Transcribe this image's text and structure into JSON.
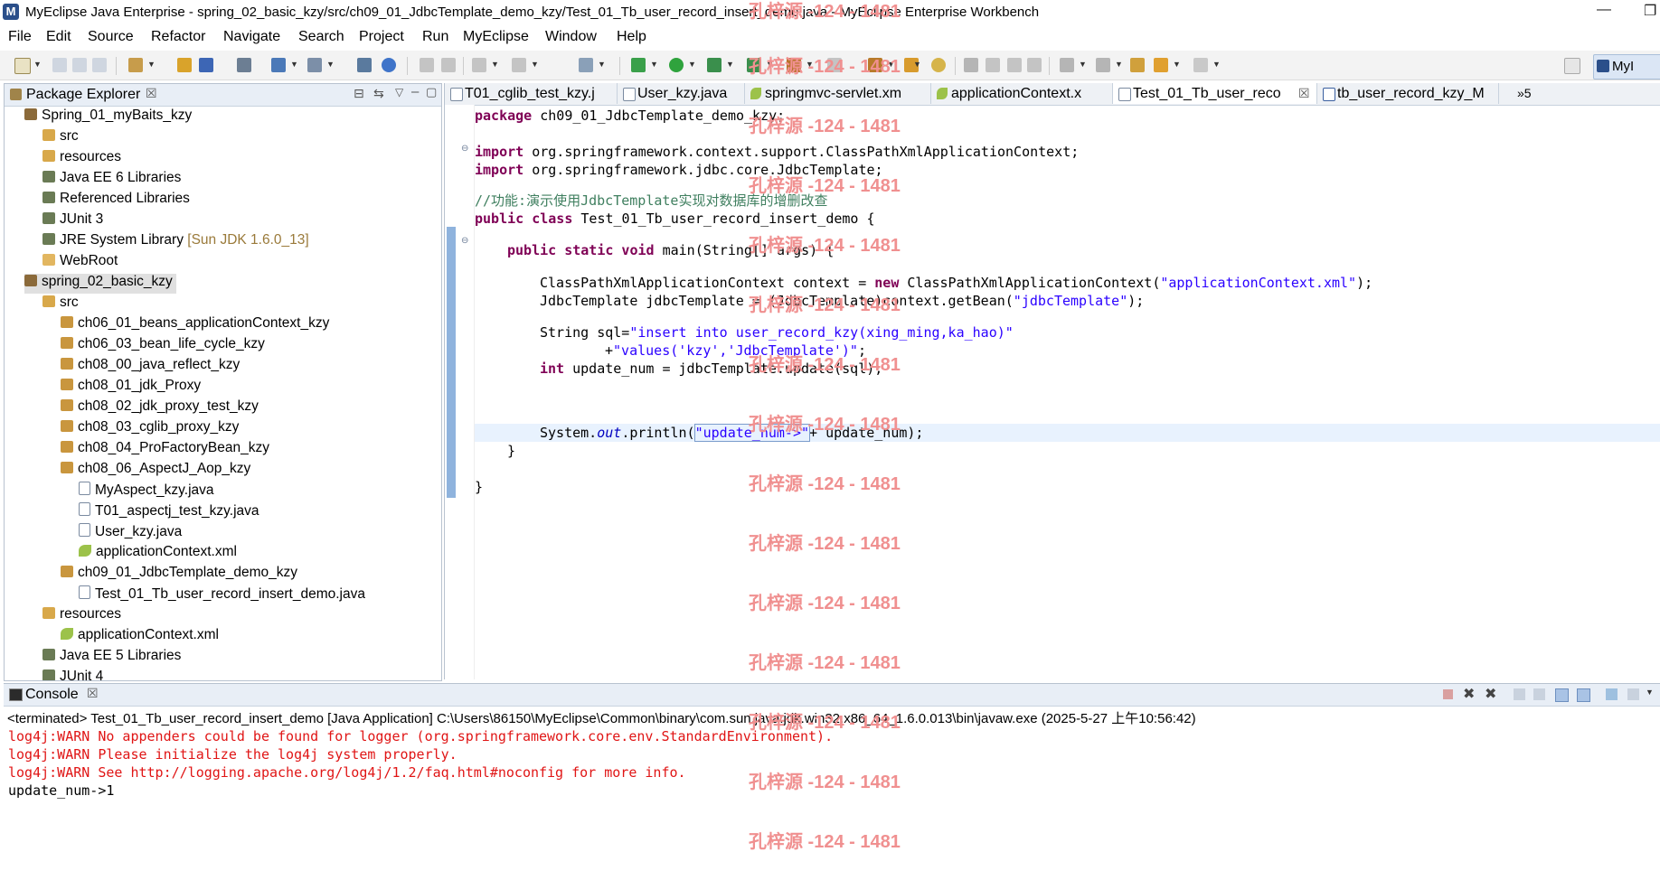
{
  "window": {
    "title": "MyEclipse Java Enterprise - spring_02_basic_kzy/src/ch09_01_JdbcTemplate_demo_kzy/Test_01_Tb_user_record_insert_demo.java - MyEclipse Enterprise Workbench",
    "controls": [
      "—",
      "❐"
    ]
  },
  "menu": [
    "File",
    "Edit",
    "Source",
    "Refactor",
    "Navigate",
    "Search",
    "Project",
    "Run",
    "MyEclipse",
    "Window",
    "Help"
  ],
  "perspective": {
    "label": "MyI"
  },
  "package_explorer": {
    "title": "Package Explorer",
    "items": [
      {
        "label": "Spring_01_myBaits_kzy",
        "level": 1
      },
      {
        "label": "src",
        "level": 2
      },
      {
        "label": "resources",
        "level": 2
      },
      {
        "label": "Java EE 6 Libraries",
        "level": 2
      },
      {
        "label": "Referenced Libraries",
        "level": 2
      },
      {
        "label": "JUnit 3",
        "level": 2
      },
      {
        "label": "JRE System Library",
        "suffix": "[Sun JDK 1.6.0_13]",
        "level": 2
      },
      {
        "label": "WebRoot",
        "level": 2
      },
      {
        "label": "spring_02_basic_kzy",
        "level": 1,
        "selected": true
      },
      {
        "label": "src",
        "level": 2
      },
      {
        "label": "ch06_01_beans_applicationContext_kzy",
        "level": 3
      },
      {
        "label": "ch06_03_bean_life_cycle_kzy",
        "level": 3
      },
      {
        "label": "ch08_00_java_reflect_kzy",
        "level": 3
      },
      {
        "label": "ch08_01_jdk_Proxy",
        "level": 3
      },
      {
        "label": "ch08_02_jdk_proxy_test_kzy",
        "level": 3
      },
      {
        "label": "ch08_03_cglib_proxy_kzy",
        "level": 3
      },
      {
        "label": "ch08_04_ProFactoryBean_kzy",
        "level": 3
      },
      {
        "label": "ch08_06_AspectJ_Aop_kzy",
        "level": 3
      },
      {
        "label": "MyAspect_kzy.java",
        "level": 4
      },
      {
        "label": "T01_aspectj_test_kzy.java",
        "level": 4
      },
      {
        "label": "User_kzy.java",
        "level": 4
      },
      {
        "label": "applicationContext.xml",
        "level": 4
      },
      {
        "label": "ch09_01_JdbcTemplate_demo_kzy",
        "level": 3
      },
      {
        "label": "Test_01_Tb_user_record_insert_demo.java",
        "level": 4
      },
      {
        "label": "resources",
        "level": 2
      },
      {
        "label": "applicationContext.xml",
        "level": 3
      },
      {
        "label": "Java EE 5 Libraries",
        "level": 2
      },
      {
        "label": "JUnit 4",
        "level": 2
      }
    ]
  },
  "editor": {
    "tabs": [
      {
        "label": "T01_cglib_test_kzy.j"
      },
      {
        "label": "User_kzy.java"
      },
      {
        "label": "springmvc-servlet.xm"
      },
      {
        "label": "applicationContext.x"
      },
      {
        "label": "Test_01_Tb_user_reco",
        "active": true,
        "close": "☒"
      },
      {
        "label": "tb_user_record_kzy_M"
      }
    ],
    "overflow": "»5",
    "code": {
      "l1_kw": "package",
      "l1_rest": " ch09_01_JdbcTemplate_demo_kzy;",
      "l2_kw": "import",
      "l2_rest": " org.springframework.context.support.ClassPathXmlApplicationContext;",
      "l3_kw": "import",
      "l3_rest": " org.springframework.jdbc.core.JdbcTemplate;",
      "l4_cmt": "//功能:演示使用JdbcTemplate实现对数据库的增删改查",
      "l5_kw": "public class",
      "l5_rest": " Test_01_Tb_user_record_insert_demo {",
      "l6_kw": "public static void",
      "l6_rest": " main(String[] args) {",
      "l7_a": "ClassPathXmlApplicationContext context = ",
      "l7_kw": "new",
      "l7_b": " ClassPathXmlApplicationContext(",
      "l7_str": "\"applicationContext.xml\"",
      "l7_c": ");",
      "l8_a": "JdbcTemplate jdbcTemplate = (JdbcTemplate)context.getBean(",
      "l8_str": "\"jdbcTemplate\"",
      "l8_c": ");",
      "l9_a": "String sql=",
      "l9_str": "\"insert into user_record_kzy(xing_ming,ka_hao)\"",
      "l10_a": "+",
      "l10_str": "\"values('kzy','JdbcTemplate')\"",
      "l10_c": ";",
      "l11_kw": "int",
      "l11_rest": " update_num = jdbcTemplate.update(sql);",
      "l12_a": "System.",
      "l12_itl": "out",
      "l12_b": ".println(",
      "l12_str": "\"update_num->\"",
      "l12_c": "+ update_num);",
      "l13": "}",
      "l14": "}"
    }
  },
  "console": {
    "title": "Console",
    "description": "<terminated> Test_01_Tb_user_record_insert_demo [Java Application] C:\\Users\\86150\\MyEclipse\\Common\\binary\\com.sun.java.jdk.win32.x86_64_1.6.0.013\\bin\\javaw.exe (2025-5-27 上午10:56:42)",
    "lines": [
      "log4j:WARN No appenders could be found for logger (org.springframework.core.env.StandardEnvironment).",
      "log4j:WARN Please initialize the log4j system properly.",
      "log4j:WARN See http://logging.apache.org/log4j/1.2/faq.html#noconfig for more info.",
      "update_num->1"
    ]
  },
  "watermark": "孔梓源 -124 - 1481",
  "colors": {
    "accent": "#2b4f8a",
    "keyword": "#7f0055",
    "string": "#2a00ff",
    "comment": "#3f7f5f",
    "error": "#e01515"
  }
}
